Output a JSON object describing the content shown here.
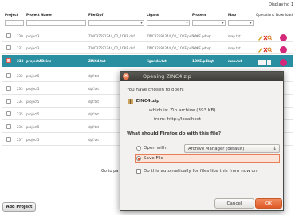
{
  "table": {
    "displaying": "Displaying 1",
    "headers": [
      "Project",
      "Project Name",
      "File Dpf",
      "Ligand",
      "Protein",
      "Map",
      "Operations",
      "Download"
    ],
    "rows": [
      {
        "id": "230",
        "name": "project3",
        "file": "ZINC32591344_02_1OKE.dpf",
        "ligand": "ZINC32591344_02_1OKE.pdbqt",
        "protein": "1OKE.pdbqt",
        "map": "map.txt",
        "selected": false
      },
      {
        "id": "231",
        "name": "project3",
        "file": "ZINC32591344_02_1OKE.dpf",
        "ligand": "ZINC32591344_02_1OKE.pdbqt",
        "protein": "1OKE.pdbqt",
        "map": "map.txt",
        "selected": false
      },
      {
        "id": "238",
        "name": "projectADzinc",
        "file": "ZINC4.txt",
        "ligand": "ligand4.txt",
        "protein": "1OKE.pdbqt",
        "map": "map.txt",
        "selected": true
      },
      {
        "id": "232",
        "name": "project5",
        "file": "dpf.txt",
        "selected": false
      },
      {
        "id": "233",
        "name": "project5",
        "file": "dpf.txt",
        "selected": false
      },
      {
        "id": "234",
        "name": "project5",
        "file": "dpf.txt",
        "selected": false
      },
      {
        "id": "235",
        "name": "project5",
        "file": "dpf.txt",
        "selected": false
      },
      {
        "id": "236",
        "name": "project5",
        "file": "dpf.txt",
        "selected": false
      },
      {
        "id": "237",
        "name": "project5",
        "file": "dpf.txt",
        "selected": false
      }
    ],
    "go_to_page": "Go to pa"
  },
  "add_project_label": "Add Project",
  "dialog": {
    "title": "Opening ZINC4.zip",
    "intro": "You have chosen to open:",
    "file_name": "ZINC4.zip",
    "which_is": "which is:  Zip archive (393 KB)",
    "from": "from:  http://localhost",
    "question": "What should Firefox do with this file?",
    "open_with_label": "Open with",
    "open_with_app": "Archive Manager (default)",
    "save_file_label": "Save File",
    "auto_label": "Do this automatically for files like this from now on.",
    "cancel_label": "Cancel",
    "ok_label": "OK"
  },
  "colors": {
    "selected_row": "#2a8fa0",
    "accent": "#e05a28",
    "download": "#d6287a"
  }
}
